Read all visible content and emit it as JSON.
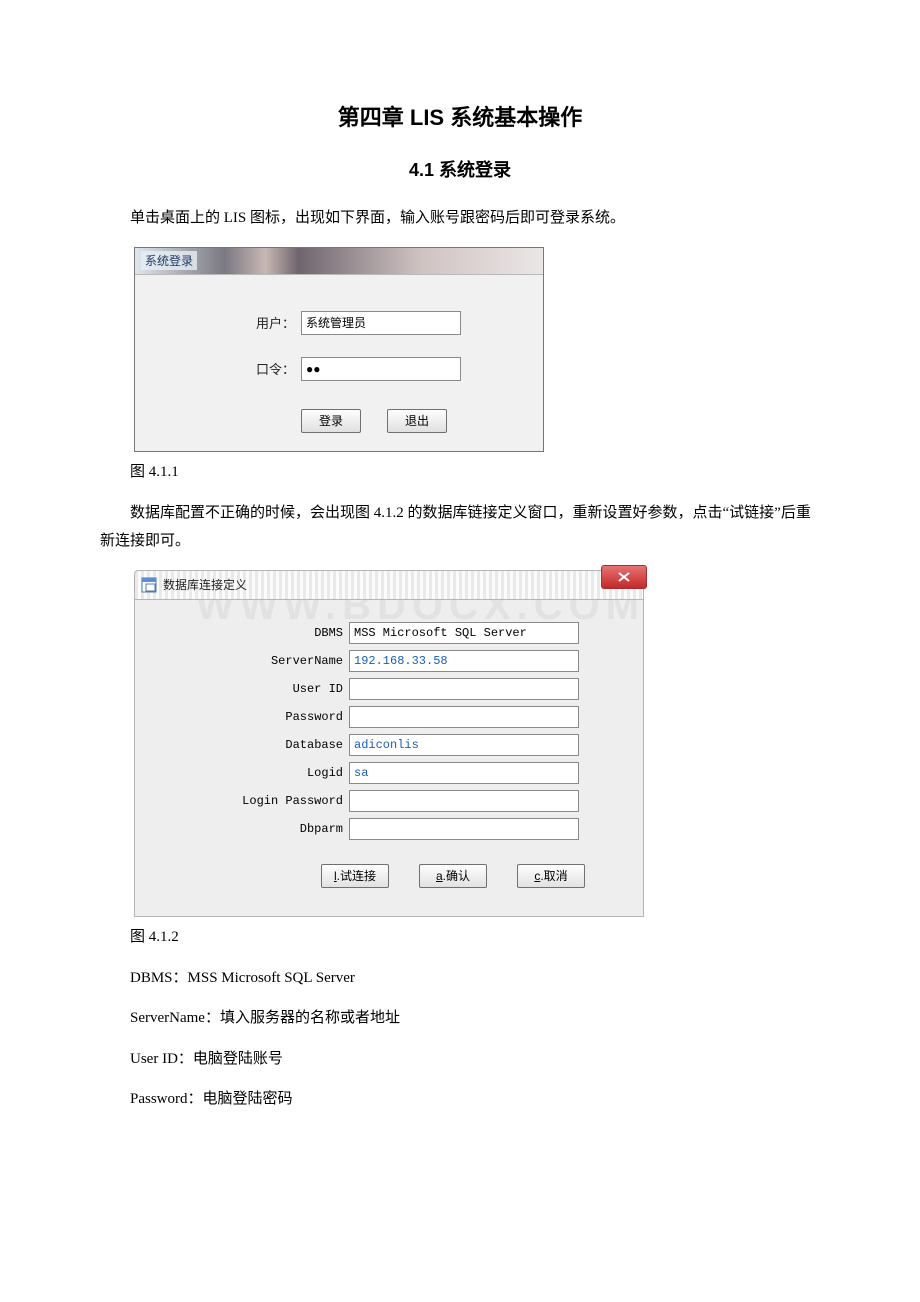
{
  "title": "第四章 LIS 系统基本操作",
  "section": "4.1 系统登录",
  "p1": "单击桌面上的 LIS 图标，出现如下界面，输入账号跟密码后即可登录系统。",
  "login": {
    "titlebar": "系统登录",
    "user_label": "用户：",
    "user_value": "系统管理员",
    "pass_label": "口令：",
    "pass_value": "●●",
    "login_btn": "登录",
    "exit_btn": "退出"
  },
  "fig1": "图 4.1.1",
  "p2": "数据库配置不正确的时候，会出现图 4.1.2 的数据库链接定义窗口，重新设置好参数，点击“试链接”后重新连接即可。",
  "db": {
    "titlebar": "数据库连接定义",
    "labels": {
      "dbms": "DBMS",
      "server": "ServerName",
      "userid": "User ID",
      "password": "Password",
      "database": "Database",
      "logid": "Logid",
      "loginpw": "Login Password",
      "dbparm": "Dbparm"
    },
    "values": {
      "dbms": "MSS Microsoft SQL Server",
      "server": "192.168.33.58",
      "userid": "",
      "password": "",
      "database": "adiconlis",
      "logid": "sa",
      "loginpw": "",
      "dbparm": ""
    },
    "buttons": {
      "test_u": "l",
      "test_rest": ".试连接",
      "ok_u": "a",
      "ok_rest": ".确认",
      "cancel_u": "c",
      "cancel_rest": ".取消"
    }
  },
  "watermark": "WWW.BDOCX.COM",
  "fig2": "图 4.1.2",
  "desc": {
    "dbms": "DBMS：MSS Microsoft SQL Server",
    "server": "ServerName：填入服务器的名称或者地址",
    "userid": "User ID：电脑登陆账号",
    "password": "Password：电脑登陆密码"
  }
}
